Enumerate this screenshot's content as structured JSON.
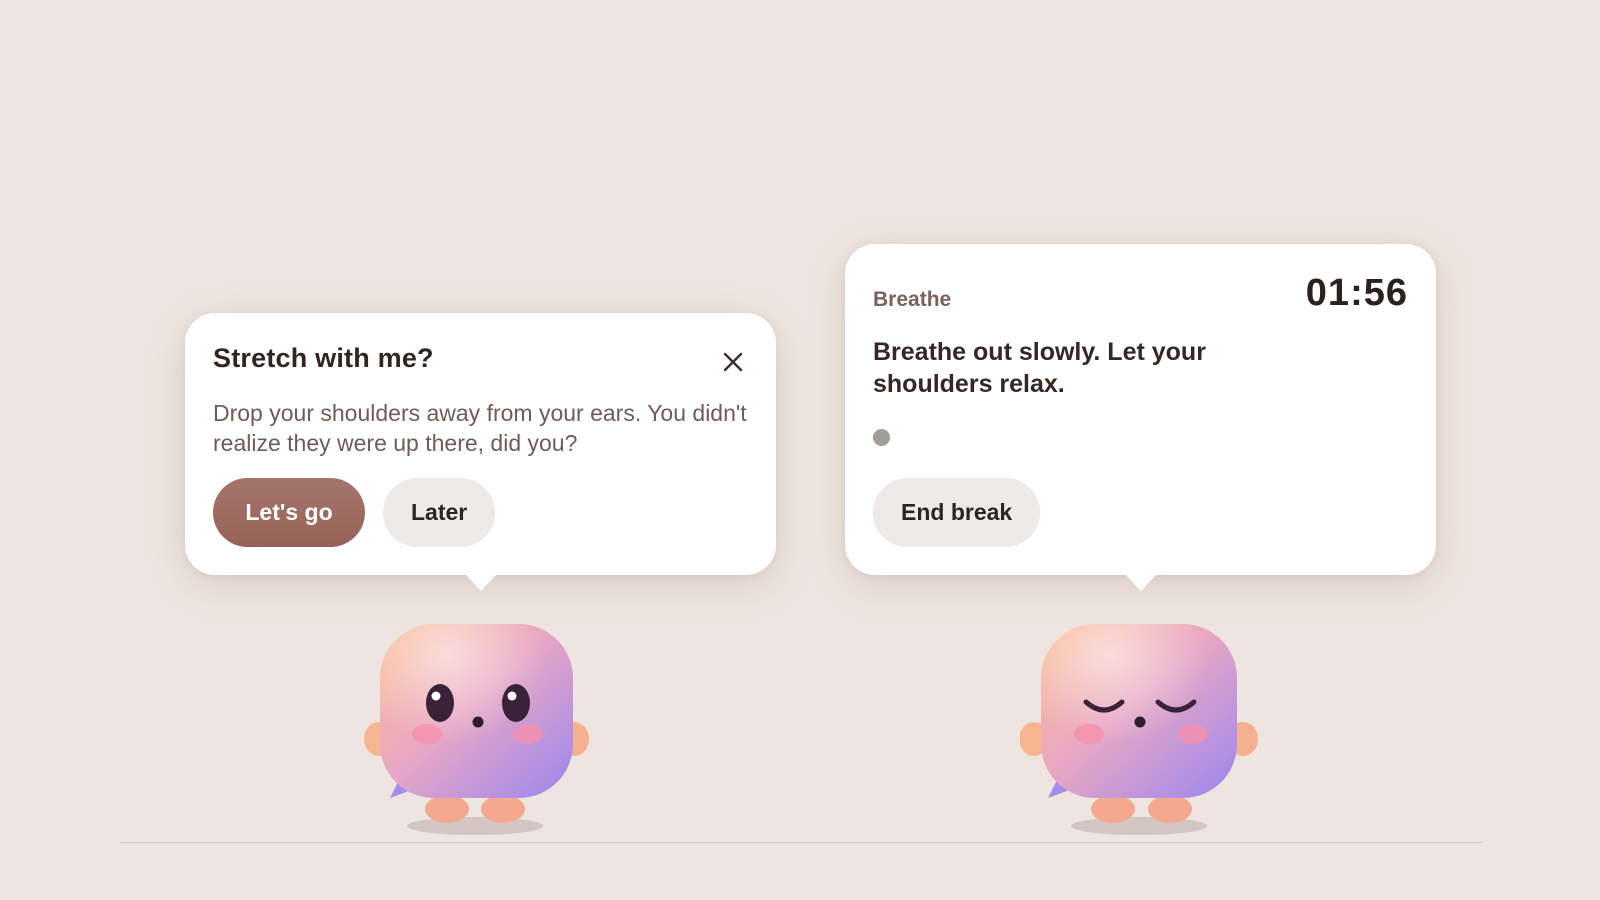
{
  "stretch_card": {
    "title": "Stretch with me?",
    "close_icon": "close-icon",
    "body": "Drop your shoulders away from your ears. You didn't realize they were up there, did you?",
    "primary_label": "Let's go",
    "secondary_label": "Later"
  },
  "breathe_card": {
    "label": "Breathe",
    "timer": "01:56",
    "instruction": "Breathe out slowly. Let your shoulders relax.",
    "end_label": "End break"
  },
  "mascots": {
    "left_icon": "mascot-awake-icon",
    "right_icon": "mascot-calm-icon"
  },
  "colors": {
    "background": "#EEE5E0",
    "primary_button": "#9F6E63",
    "secondary_button": "#EEEAE9",
    "card": "#FFFFFF"
  }
}
